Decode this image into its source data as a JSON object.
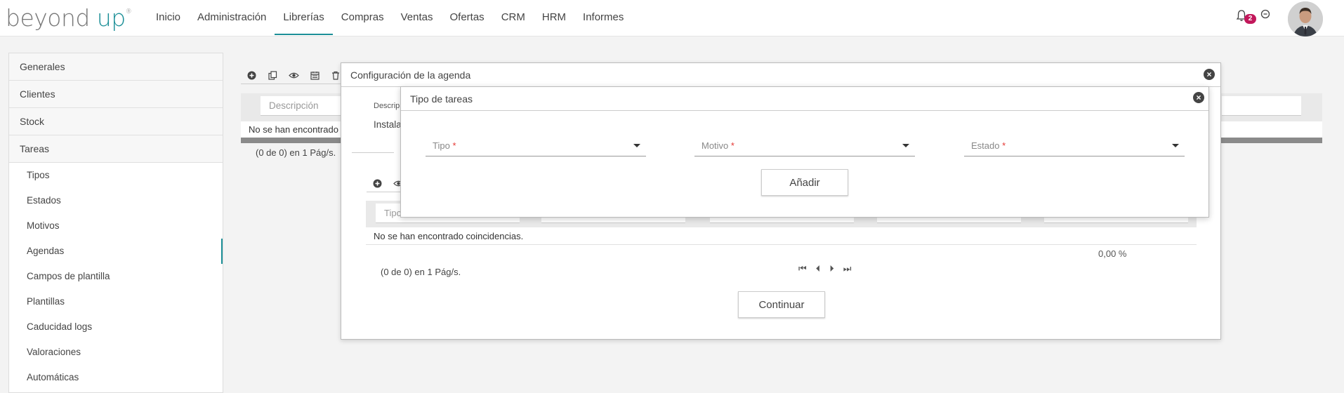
{
  "brand": {
    "name_a": "beyond ",
    "name_b": "up",
    "reg": "®",
    "accent": "#1c8f97"
  },
  "nav": {
    "items": [
      "Inicio",
      "Administración",
      "Librerías",
      "Compras",
      "Ventas",
      "Ofertas",
      "CRM",
      "HRM",
      "Informes"
    ],
    "active": "Librerías",
    "notification_count": "2"
  },
  "sidebar": {
    "sections": [
      "Generales",
      "Clientes",
      "Stock",
      "Tareas"
    ],
    "sub_items": [
      "Tipos",
      "Estados",
      "Motivos",
      "Agendas",
      "Campos de plantilla",
      "Plantillas",
      "Caducidad logs",
      "Valoraciones",
      "Automáticas"
    ],
    "active_sub": "Agendas"
  },
  "background_list": {
    "filter_placeholder": "Descripción",
    "empty_text": "No se han encontrado coincidencias.",
    "empty_text_visible": "No se han encontrado",
    "pager": "(0 de 0) en 1 Pág/s."
  },
  "dialog_agenda": {
    "title": "Configuración de la agenda",
    "desc_label": "Descrip",
    "desc_value": "Instala",
    "filter_visible": "Tipo",
    "empty_text": "No se han encontrado coincidencias.",
    "percent": "0,00 %",
    "pager": "(0 de 0) en 1 Pág/s.",
    "continue_label": "Continuar"
  },
  "dialog_tipo": {
    "title": "Tipo de tareas",
    "fields": [
      {
        "label": "Tipo",
        "required": "*"
      },
      {
        "label": "Motivo",
        "required": "*"
      },
      {
        "label": "Estado",
        "required": "*"
      }
    ],
    "add_label": "Añadir"
  }
}
